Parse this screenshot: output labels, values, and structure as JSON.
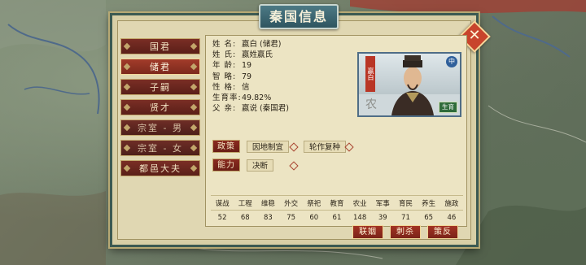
{
  "dialog": {
    "title": "秦国信息",
    "close_label": "✕"
  },
  "menu": [
    {
      "label": "国君",
      "state": "normal"
    },
    {
      "label": "储君",
      "state": "active"
    },
    {
      "label": "子嗣",
      "state": "normal"
    },
    {
      "label": "贤才",
      "state": "normal"
    },
    {
      "label": "宗室 - 男",
      "state": "dim"
    },
    {
      "label": "宗室 - 女",
      "state": "dim"
    },
    {
      "label": "都邑大夫",
      "state": "normal"
    }
  ],
  "info": [
    {
      "key": "姓  名:",
      "value": "嬴白 (储君)"
    },
    {
      "key": "姓  氏:",
      "value": "嬴姓嬴氏"
    },
    {
      "key": "年  龄:",
      "value": "19"
    },
    {
      "key": "智  略:",
      "value": "79"
    },
    {
      "key": "性  格:",
      "value": "信"
    },
    {
      "key": "生育率:",
      "value": "49.82%"
    },
    {
      "key": "父  亲:",
      "value": "嬴说 (秦国君)"
    }
  ],
  "portrait": {
    "banner": "嬴白",
    "badge": "中",
    "tag": "生育",
    "stamp": "农"
  },
  "policy": {
    "label": "政策",
    "items": [
      "因地制宜",
      "轮作复种"
    ]
  },
  "ability": {
    "label": "能力",
    "items": [
      "决断"
    ]
  },
  "stats": {
    "headers": [
      "谋战",
      "工程",
      "维稳",
      "外交",
      "祭祀",
      "教育",
      "农业",
      "军事",
      "育民",
      "养生",
      "施政"
    ],
    "values": [
      "52",
      "68",
      "83",
      "75",
      "60",
      "61",
      "148",
      "39",
      "71",
      "65",
      "46"
    ]
  },
  "actions": {
    "alliance": "联姻",
    "kill": "刺杀",
    "rebel": "策反"
  },
  "colors": {
    "accent": "#8a2a1f",
    "frame": "#3c5a52",
    "parchment": "#e0d7b2"
  }
}
